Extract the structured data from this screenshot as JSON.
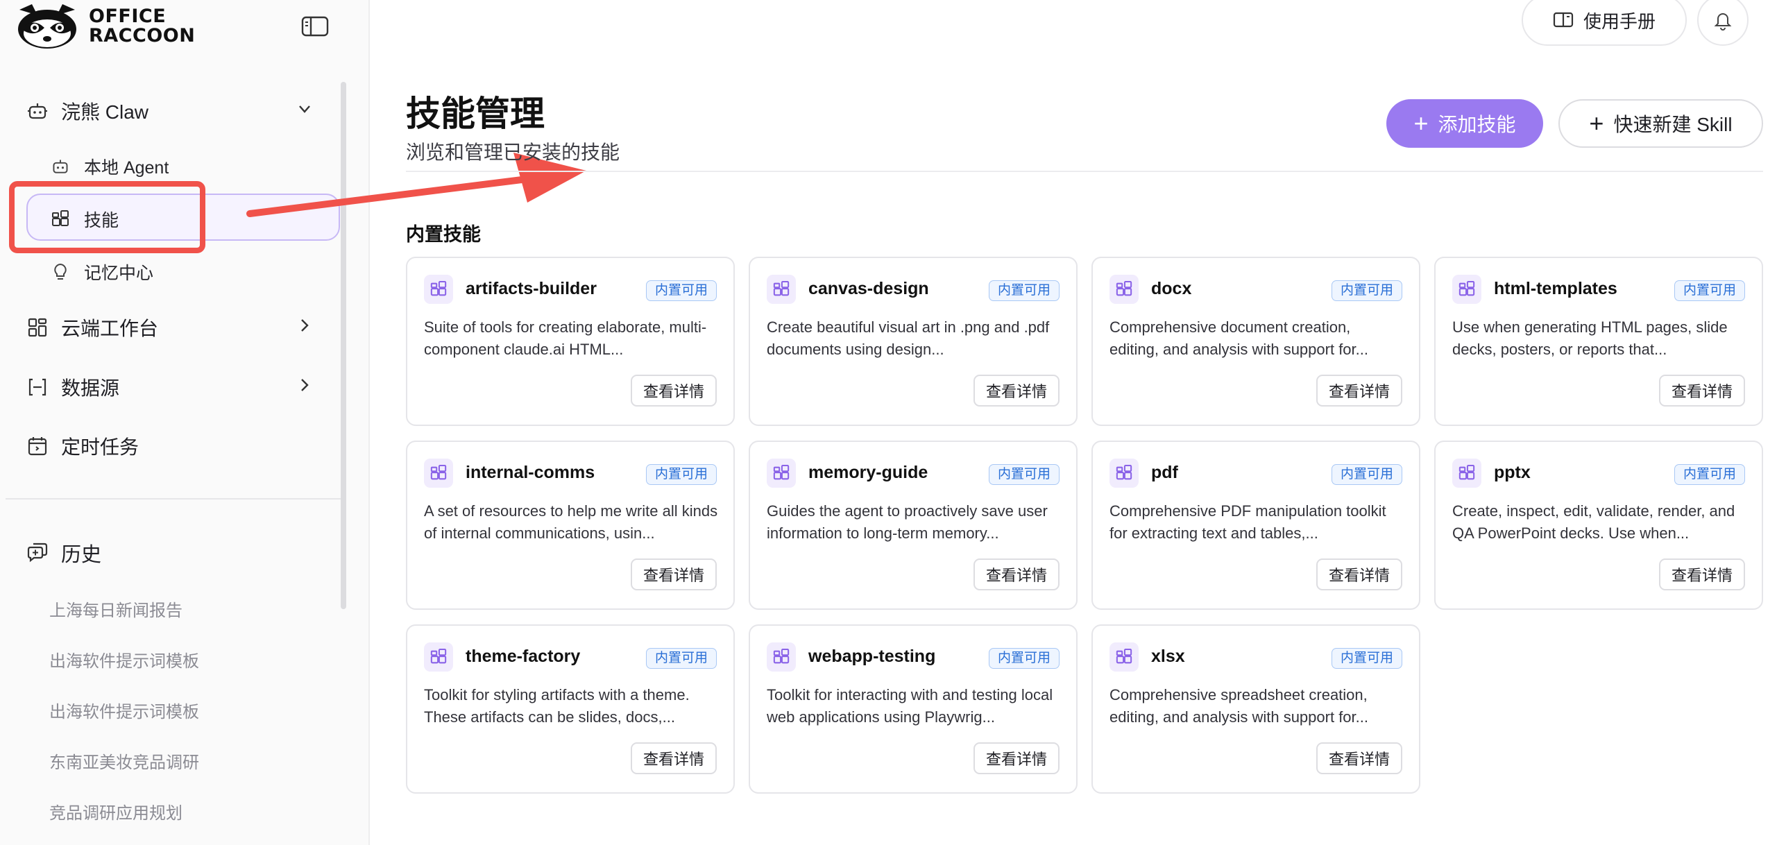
{
  "brand": {
    "line1": "OFFICE",
    "line2": "RACCOON"
  },
  "sidebar": {
    "claw_group": {
      "label": "浣熊 Claw"
    },
    "sub_items": [
      {
        "label": "本地 Agent",
        "icon": "robot-icon"
      },
      {
        "label": "技能",
        "icon": "apps-icon"
      },
      {
        "label": "记忆中心",
        "icon": "lightbulb-icon"
      }
    ],
    "cloud": {
      "label": "云端工作台"
    },
    "datasource": {
      "label": "数据源"
    },
    "tasks": {
      "label": "定时任务"
    },
    "history": {
      "title": "历史",
      "items": [
        "上海每日新闻报告",
        "出海软件提示词模板",
        "出海软件提示词模板",
        "东南亚美妆竞品调研",
        "竞品调研应用规划"
      ]
    }
  },
  "topbar": {
    "manual_label": "使用手册"
  },
  "page": {
    "title": "技能管理",
    "subtitle": "浏览和管理已安装的技能",
    "add_label": "添加技能",
    "quick_label": "快速新建 Skill",
    "section_title": "内置技能"
  },
  "skills": [
    {
      "name": "artifacts-builder",
      "badge": "内置可用",
      "desc": "Suite of tools for creating elaborate, multi-component claude.ai HTML...",
      "action": "查看详情"
    },
    {
      "name": "canvas-design",
      "badge": "内置可用",
      "desc": "Create beautiful visual art in .png and .pdf documents using design...",
      "action": "查看详情"
    },
    {
      "name": "docx",
      "badge": "内置可用",
      "desc": "Comprehensive document creation, editing, and analysis with support for...",
      "action": "查看详情"
    },
    {
      "name": "html-templates",
      "badge": "内置可用",
      "desc": "Use when generating HTML pages, slide decks, posters, or reports that...",
      "action": "查看详情"
    },
    {
      "name": "internal-comms",
      "badge": "内置可用",
      "desc": "A set of resources to help me write all kinds of internal communications, usin...",
      "action": "查看详情"
    },
    {
      "name": "memory-guide",
      "badge": "内置可用",
      "desc": "Guides the agent to proactively save user information to long-term memory...",
      "action": "查看详情"
    },
    {
      "name": "pdf",
      "badge": "内置可用",
      "desc": "Comprehensive PDF manipulation toolkit for extracting text and tables,...",
      "action": "查看详情"
    },
    {
      "name": "pptx",
      "badge": "内置可用",
      "desc": "Create, inspect, edit, validate, render, and QA PowerPoint decks. Use when...",
      "action": "查看详情"
    },
    {
      "name": "theme-factory",
      "badge": "内置可用",
      "desc": "Toolkit for styling artifacts with a theme. These artifacts can be slides, docs,...",
      "action": "查看详情"
    },
    {
      "name": "webapp-testing",
      "badge": "内置可用",
      "desc": "Toolkit for interacting with and testing local web applications using Playwrig...",
      "action": "查看详情"
    },
    {
      "name": "xlsx",
      "badge": "内置可用",
      "desc": "Comprehensive spreadsheet creation, editing, and analysis with support for...",
      "action": "查看详情"
    }
  ],
  "colors": {
    "accent": "#9a7af0",
    "highlight": "#f0524a",
    "badge": "#2a6fd6"
  }
}
